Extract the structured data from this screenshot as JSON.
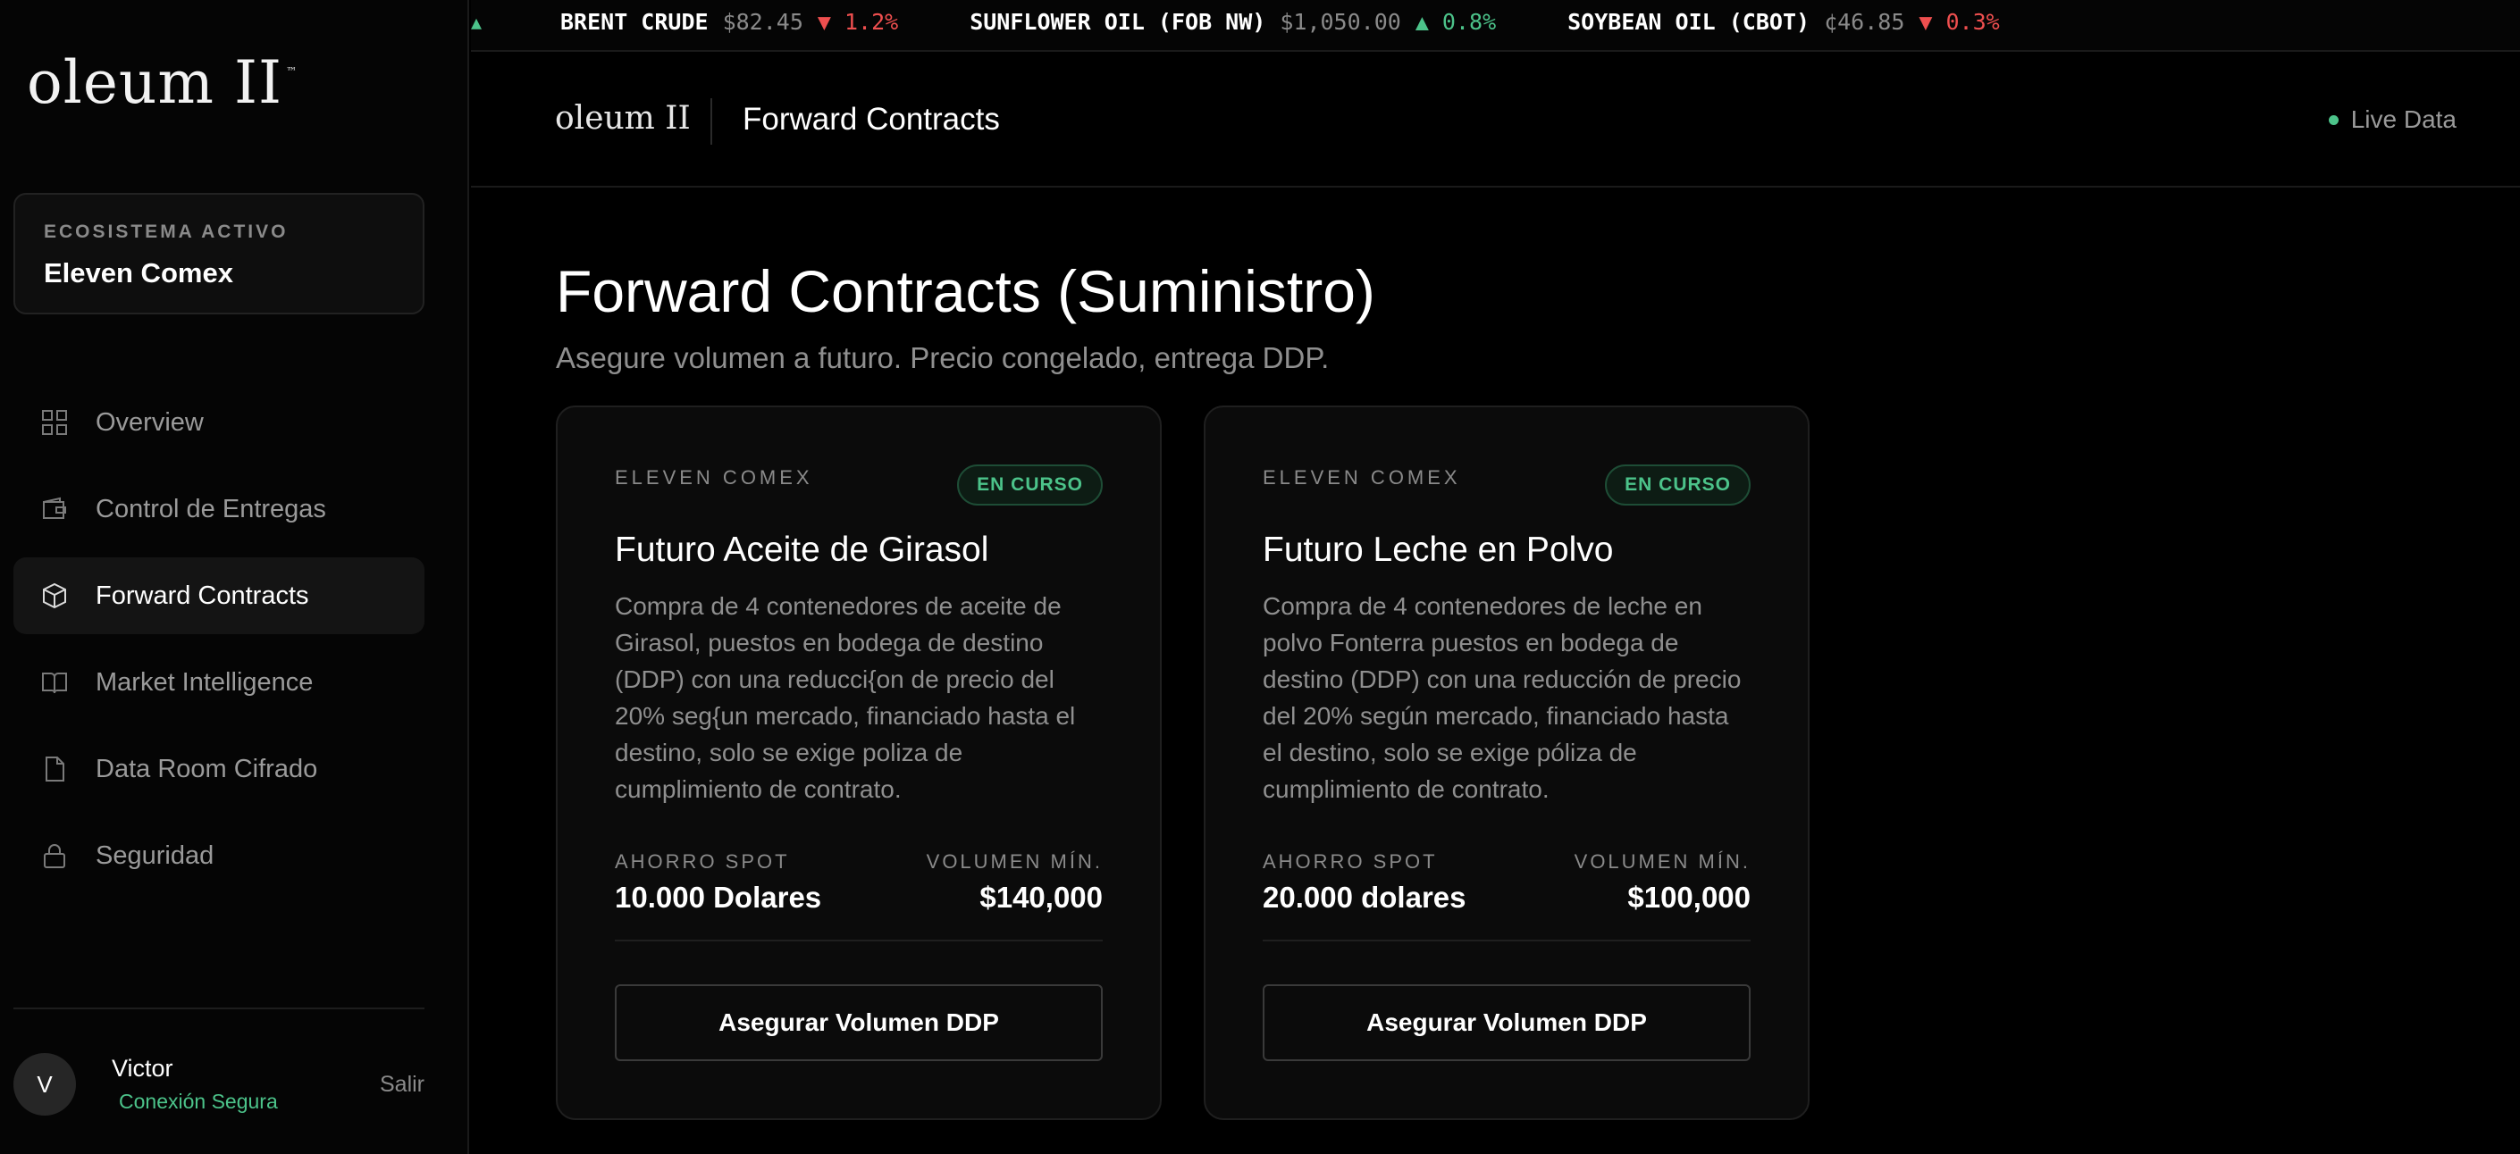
{
  "brand": {
    "logo": "oleum II",
    "logo_mark": "™"
  },
  "ecosystem": {
    "label": "ECOSISTEMA ACTIVO",
    "name": "Eleven Comex"
  },
  "nav": [
    {
      "label": "Overview",
      "icon": "grid-icon",
      "active": false
    },
    {
      "label": "Control de Entregas",
      "icon": "wallet-icon",
      "active": false
    },
    {
      "label": "Forward Contracts",
      "icon": "box-icon",
      "active": true
    },
    {
      "label": "Market Intelligence",
      "icon": "book-icon",
      "active": false
    },
    {
      "label": "Data Room Cifrado",
      "icon": "file-icon",
      "active": false
    },
    {
      "label": "Seguridad",
      "icon": "lock-icon",
      "active": false
    }
  ],
  "user": {
    "initial": "V",
    "name": "Victor",
    "status": "Conexión Segura",
    "logout": "Salir"
  },
  "ticker": [
    {
      "symbol": "BRENT CRUDE",
      "price": "$82.45",
      "change": "▼ 1.2%",
      "direction": "down"
    },
    {
      "symbol": "SUNFLOWER OIL (FOB NW)",
      "price": "$1,050.00",
      "change": "▲ 0.8%",
      "direction": "up"
    },
    {
      "symbol": "SOYBEAN OIL (CBOT)",
      "price": "¢46.85",
      "change": "▼ 0.3%",
      "direction": "down"
    }
  ],
  "header": {
    "logo": "oleum II",
    "title": "Forward Contracts",
    "live": "Live Data"
  },
  "main": {
    "title": "Forward Contracts (Suministro)",
    "subtitle": "Asegure volumen a futuro. Precio congelado, entrega DDP."
  },
  "cards": [
    {
      "company": "ELEVEN COMEX",
      "badge": "EN CURSO",
      "title": "Futuro Aceite de Girasol",
      "description": "Compra de 4 contenedores de aceite de Girasol, puestos en bodega de destino (DDP) con una reducci{on de precio del 20% seg{un mercado, financiado hasta el destino, solo se exige poliza de cumplimiento de contrato.",
      "savings_label": "AHORRO SPOT",
      "savings_value": "10.000 Dolares",
      "volume_label": "VOLUMEN MÍN.",
      "volume_value": "$140,000",
      "cta": "Asegurar Volumen DDP"
    },
    {
      "company": "ELEVEN COMEX",
      "badge": "EN CURSO",
      "title": "Futuro Leche en Polvo",
      "description": "Compra de 4 contenedores de leche en polvo Fonterra puestos en bodega de destino (DDP) con una reducción de precio del 20% según mercado, financiado hasta el destino, solo se exige póliza de cumplimiento de contrato.",
      "savings_label": "AHORRO SPOT",
      "savings_value": "20.000 dolares",
      "volume_label": "VOLUMEN MÍN.",
      "volume_value": "$100,000",
      "cta": "Asegurar Volumen DDP"
    }
  ],
  "colors": {
    "accent_green": "#4cc38a",
    "down_red": "#ef4f4f",
    "background": "#000000"
  }
}
